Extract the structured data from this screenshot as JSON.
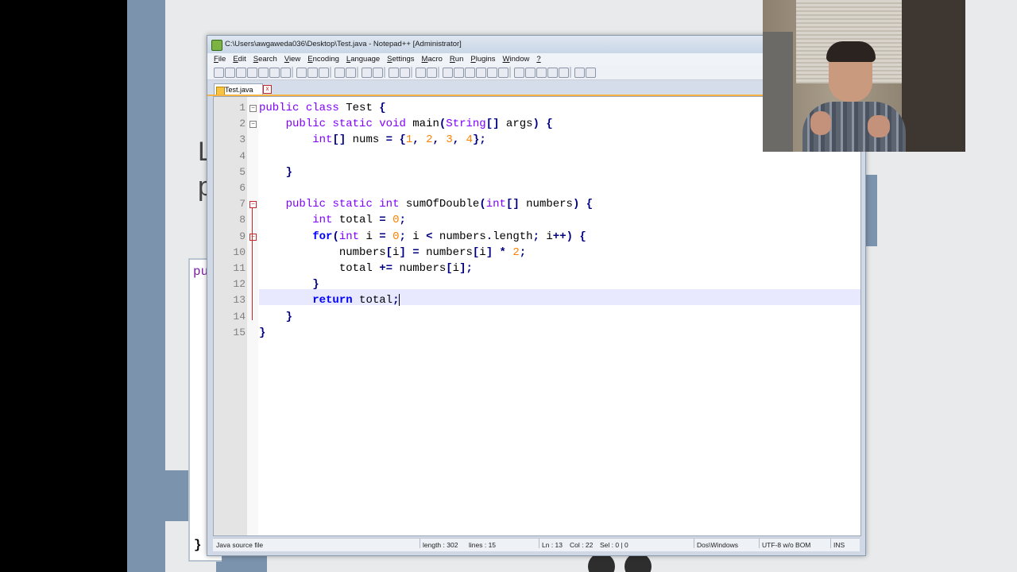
{
  "window": {
    "title": "C:\\Users\\awgaweda036\\Desktop\\Test.java - Notepad++ [Administrator]"
  },
  "menu": [
    {
      "label": "File",
      "u": "F",
      "rest": "ile"
    },
    {
      "label": "Edit",
      "u": "E",
      "rest": "dit"
    },
    {
      "label": "Search",
      "u": "S",
      "rest": "earch"
    },
    {
      "label": "View",
      "u": "V",
      "rest": "iew"
    },
    {
      "label": "Encoding",
      "u": "E",
      "rest": "ncoding"
    },
    {
      "label": "Language",
      "u": "L",
      "rest": "anguage"
    },
    {
      "label": "Settings",
      "u": "S",
      "rest": "ettings"
    },
    {
      "label": "Macro",
      "u": "M",
      "rest": "acro"
    },
    {
      "label": "Run",
      "u": "R",
      "rest": "un"
    },
    {
      "label": "Plugins",
      "u": "P",
      "rest": "lugins"
    },
    {
      "label": "Window",
      "u": "W",
      "rest": "indow"
    },
    {
      "label": "?",
      "u": "?",
      "rest": ""
    }
  ],
  "tab": {
    "label": "Test.java",
    "close": "x"
  },
  "code_lines": [
    {
      "n": "1",
      "text": "public class Test {"
    },
    {
      "n": "2",
      "text": "    public static void main(String[] args) {"
    },
    {
      "n": "3",
      "text": "        int[] nums = {1, 2, 3, 4};"
    },
    {
      "n": "4",
      "text": ""
    },
    {
      "n": "5",
      "text": "    }"
    },
    {
      "n": "6",
      "text": ""
    },
    {
      "n": "7",
      "text": "    public static int sumOfDouble(int[] numbers) {"
    },
    {
      "n": "8",
      "text": "        int total = 0;"
    },
    {
      "n": "9",
      "text": "        for(int i = 0; i < numbers.length; i++) {"
    },
    {
      "n": "10",
      "text": "            numbers[i] = numbers[i] * 2;"
    },
    {
      "n": "11",
      "text": "            total += numbers[i];"
    },
    {
      "n": "12",
      "text": "        }"
    },
    {
      "n": "13",
      "text": "        return total;"
    },
    {
      "n": "14",
      "text": "    }"
    },
    {
      "n": "15",
      "text": "}"
    }
  ],
  "status": {
    "file_type": "Java source file",
    "length": "length : 302",
    "lines": "lines : 15",
    "ln": "Ln : 13",
    "col": "Col : 22",
    "sel": "Sel : 0 | 0",
    "eol": "Dos\\Windows",
    "encoding": "UTF-8 w/o BOM",
    "mode": "INS"
  },
  "slide": {
    "text_fragment_1": "L",
    "text_fragment_2": "p",
    "code_fragment": "pu",
    "code_brace": "}"
  },
  "colors": {
    "keyword": "#8000ff",
    "flow_keyword": "#0000ff",
    "number": "#ff8000",
    "operator": "#000080",
    "current_line": "#e8e8ff"
  }
}
